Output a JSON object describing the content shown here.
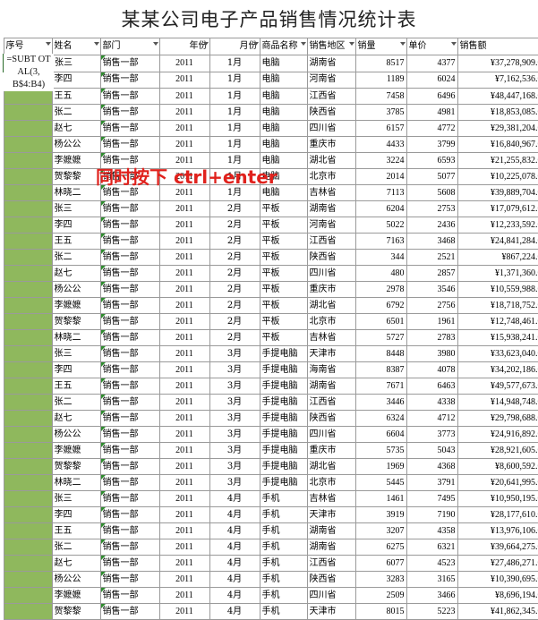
{
  "sheet_title": "某某公司电子产品销售情况统计表",
  "headers": [
    "序号",
    "姓名",
    "部门",
    "年份",
    "月份",
    "商品名称",
    "销售地区",
    "销量",
    "单价",
    "销售额"
  ],
  "formula_text": "=SUBTOTAL(3,B$4:B4)",
  "formula_lines": [
    "=SUBT OT",
    "AL(3,",
    "B$4:B4)"
  ],
  "overlay_text": "同时按下 ctrl+enter",
  "colors": {
    "seq_fill": "#8fb85d",
    "overlay": "#e0211c",
    "marker": "#2e8b2e"
  },
  "rows": [
    {
      "name": "张三",
      "dept": "销售一部",
      "year": "2011",
      "month": "1月",
      "product": "电脑",
      "region": "湖南省",
      "qty": "8517",
      "price": "4377",
      "sales": "¥37,278,909.0"
    },
    {
      "name": "李四",
      "dept": "销售一部",
      "year": "2011",
      "month": "1月",
      "product": "电脑",
      "region": "河南省",
      "qty": "1189",
      "price": "6024",
      "sales": "¥7,162,536.0"
    },
    {
      "name": "王五",
      "dept": "销售一部",
      "year": "2011",
      "month": "1月",
      "product": "电脑",
      "region": "江西省",
      "qty": "7458",
      "price": "6496",
      "sales": "¥48,447,168.0"
    },
    {
      "name": "张二",
      "dept": "销售一部",
      "year": "2011",
      "month": "1月",
      "product": "电脑",
      "region": "陕西省",
      "qty": "3785",
      "price": "4981",
      "sales": "¥18,853,085.0"
    },
    {
      "name": "赵七",
      "dept": "销售一部",
      "year": "2011",
      "month": "1月",
      "product": "电脑",
      "region": "四川省",
      "qty": "6157",
      "price": "4772",
      "sales": "¥29,381,204.0"
    },
    {
      "name": "杨公公",
      "dept": "销售一部",
      "year": "2011",
      "month": "1月",
      "product": "电脑",
      "region": "重庆市",
      "qty": "4433",
      "price": "3799",
      "sales": "¥16,840,967.0"
    },
    {
      "name": "李嬷嬷",
      "dept": "销售一部",
      "year": "2011",
      "month": "1月",
      "product": "电脑",
      "region": "湖北省",
      "qty": "3224",
      "price": "6593",
      "sales": "¥21,255,832.0"
    },
    {
      "name": "贺黎黎",
      "dept": "销售一部",
      "year": "2011",
      "month": "1月",
      "product": "电脑",
      "region": "北京市",
      "qty": "2014",
      "price": "5077",
      "sales": "¥10,225,078.0"
    },
    {
      "name": "林晓二",
      "dept": "销售一部",
      "year": "2011",
      "month": "1月",
      "product": "电脑",
      "region": "吉林省",
      "qty": "7113",
      "price": "5608",
      "sales": "¥39,889,704.0"
    },
    {
      "name": "张三",
      "dept": "销售一部",
      "year": "2011",
      "month": "2月",
      "product": "平板",
      "region": "湖南省",
      "qty": "6204",
      "price": "2753",
      "sales": "¥17,079,612.0"
    },
    {
      "name": "李四",
      "dept": "销售一部",
      "year": "2011",
      "month": "2月",
      "product": "平板",
      "region": "河南省",
      "qty": "5022",
      "price": "2436",
      "sales": "¥12,233,592.0"
    },
    {
      "name": "王五",
      "dept": "销售一部",
      "year": "2011",
      "month": "2月",
      "product": "平板",
      "region": "江西省",
      "qty": "7163",
      "price": "3468",
      "sales": "¥24,841,284.0"
    },
    {
      "name": "张二",
      "dept": "销售一部",
      "year": "2011",
      "month": "2月",
      "product": "平板",
      "region": "陕西省",
      "qty": "344",
      "price": "2521",
      "sales": "¥867,224.0"
    },
    {
      "name": "赵七",
      "dept": "销售一部",
      "year": "2011",
      "month": "2月",
      "product": "平板",
      "region": "四川省",
      "qty": "480",
      "price": "2857",
      "sales": "¥1,371,360.0"
    },
    {
      "name": "杨公公",
      "dept": "销售一部",
      "year": "2011",
      "month": "2月",
      "product": "平板",
      "region": "重庆市",
      "qty": "2978",
      "price": "3546",
      "sales": "¥10,559,988.0"
    },
    {
      "name": "李嬷嬷",
      "dept": "销售一部",
      "year": "2011",
      "month": "2月",
      "product": "平板",
      "region": "湖北省",
      "qty": "6792",
      "price": "2756",
      "sales": "¥18,718,752.0"
    },
    {
      "name": "贺黎黎",
      "dept": "销售一部",
      "year": "2011",
      "month": "2月",
      "product": "平板",
      "region": "北京市",
      "qty": "6501",
      "price": "1961",
      "sales": "¥12,748,461.0"
    },
    {
      "name": "林晓二",
      "dept": "销售一部",
      "year": "2011",
      "month": "2月",
      "product": "平板",
      "region": "吉林省",
      "qty": "5727",
      "price": "2783",
      "sales": "¥15,938,241.0"
    },
    {
      "name": "张三",
      "dept": "销售一部",
      "year": "2011",
      "month": "3月",
      "product": "手提电脑",
      "region": "天津市",
      "qty": "8448",
      "price": "3980",
      "sales": "¥33,623,040.0"
    },
    {
      "name": "李四",
      "dept": "销售一部",
      "year": "2011",
      "month": "3月",
      "product": "手提电脑",
      "region": "海南省",
      "qty": "8387",
      "price": "4078",
      "sales": "¥34,202,186.0"
    },
    {
      "name": "王五",
      "dept": "销售一部",
      "year": "2011",
      "month": "3月",
      "product": "手提电脑",
      "region": "湖南省",
      "qty": "7671",
      "price": "6463",
      "sales": "¥49,577,673.0"
    },
    {
      "name": "张二",
      "dept": "销售一部",
      "year": "2011",
      "month": "3月",
      "product": "手提电脑",
      "region": "江西省",
      "qty": "3446",
      "price": "4338",
      "sales": "¥14,948,748.0"
    },
    {
      "name": "赵七",
      "dept": "销售一部",
      "year": "2011",
      "month": "3月",
      "product": "手提电脑",
      "region": "陕西省",
      "qty": "6324",
      "price": "4712",
      "sales": "¥29,798,688.0"
    },
    {
      "name": "杨公公",
      "dept": "销售一部",
      "year": "2011",
      "month": "3月",
      "product": "手提电脑",
      "region": "四川省",
      "qty": "6604",
      "price": "3773",
      "sales": "¥24,916,892.0"
    },
    {
      "name": "李嬷嬷",
      "dept": "销售一部",
      "year": "2011",
      "month": "3月",
      "product": "手提电脑",
      "region": "重庆市",
      "qty": "5735",
      "price": "5043",
      "sales": "¥28,921,605.0"
    },
    {
      "name": "贺黎黎",
      "dept": "销售一部",
      "year": "2011",
      "month": "3月",
      "product": "手提电脑",
      "region": "湖北省",
      "qty": "1969",
      "price": "4368",
      "sales": "¥8,600,592.0"
    },
    {
      "name": "林晓二",
      "dept": "销售一部",
      "year": "2011",
      "month": "3月",
      "product": "手提电脑",
      "region": "北京市",
      "qty": "5445",
      "price": "3791",
      "sales": "¥20,641,995.0"
    },
    {
      "name": "张三",
      "dept": "销售一部",
      "year": "2011",
      "month": "4月",
      "product": "手机",
      "region": "吉林省",
      "qty": "1461",
      "price": "7495",
      "sales": "¥10,950,195.0"
    },
    {
      "name": "李四",
      "dept": "销售一部",
      "year": "2011",
      "month": "4月",
      "product": "手机",
      "region": "天津市",
      "qty": "3919",
      "price": "7190",
      "sales": "¥28,177,610.0"
    },
    {
      "name": "王五",
      "dept": "销售一部",
      "year": "2011",
      "month": "4月",
      "product": "手机",
      "region": "湖南省",
      "qty": "3207",
      "price": "4358",
      "sales": "¥13,976,106.0"
    },
    {
      "name": "张二",
      "dept": "销售一部",
      "year": "2011",
      "month": "4月",
      "product": "手机",
      "region": "湖南省",
      "qty": "6275",
      "price": "6321",
      "sales": "¥39,664,275.0"
    },
    {
      "name": "赵七",
      "dept": "销售一部",
      "year": "2011",
      "month": "4月",
      "product": "手机",
      "region": "江西省",
      "qty": "6077",
      "price": "4523",
      "sales": "¥27,486,271.0"
    },
    {
      "name": "杨公公",
      "dept": "销售一部",
      "year": "2011",
      "month": "4月",
      "product": "手机",
      "region": "陕西省",
      "qty": "3283",
      "price": "3165",
      "sales": "¥10,390,695.0"
    },
    {
      "name": "李嬷嬷",
      "dept": "销售一部",
      "year": "2011",
      "month": "4月",
      "product": "手机",
      "region": "四川省",
      "qty": "2509",
      "price": "3466",
      "sales": "¥8,696,194.0"
    },
    {
      "name": "贺黎黎",
      "dept": "销售一部",
      "year": "2011",
      "month": "4月",
      "product": "手机",
      "region": "天津市",
      "qty": "8015",
      "price": "5223",
      "sales": "¥41,862,345.0"
    }
  ]
}
